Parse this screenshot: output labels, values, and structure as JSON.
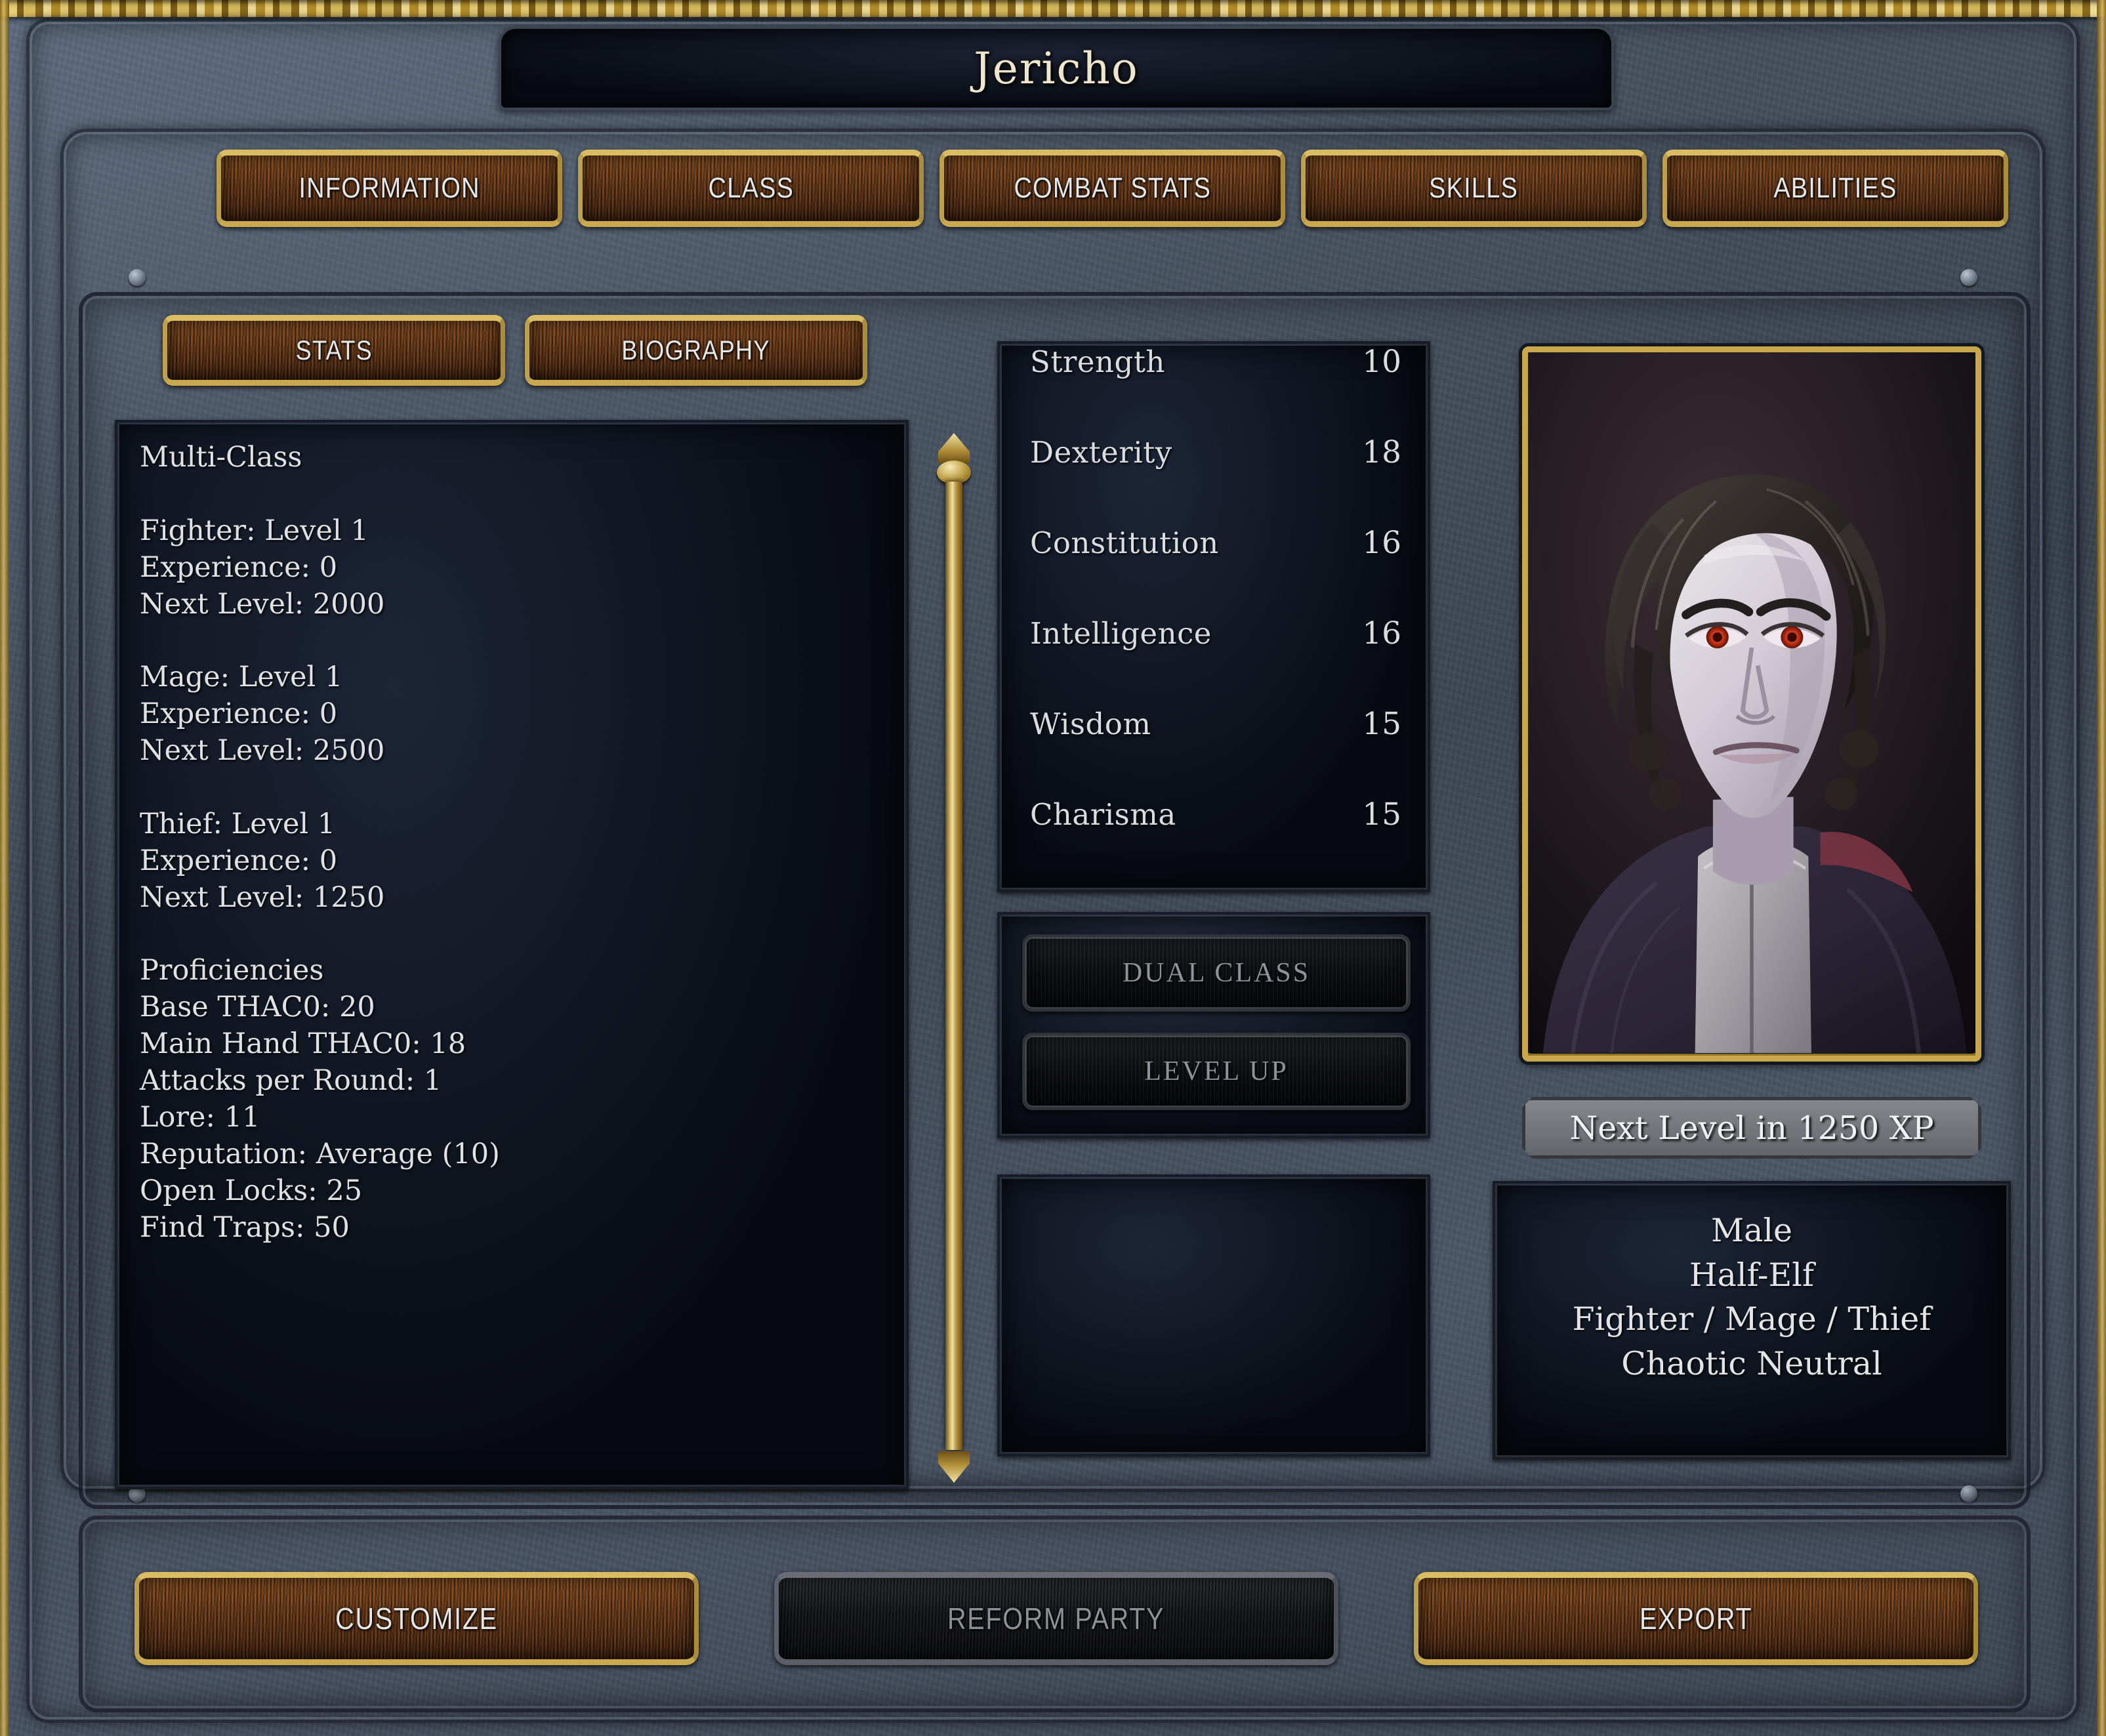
{
  "window": {
    "character_name": "Jericho"
  },
  "main_tabs": [
    {
      "label": "INFORMATION",
      "state": "active"
    },
    {
      "label": "CLASS",
      "state": "normal"
    },
    {
      "label": "COMBAT STATS",
      "state": "normal"
    },
    {
      "label": "SKILLS",
      "state": "normal"
    },
    {
      "label": "ABILITIES",
      "state": "normal"
    }
  ],
  "sub_tabs": [
    {
      "label": "STATS",
      "state": "active"
    },
    {
      "label": "BIOGRAPHY",
      "state": "normal"
    }
  ],
  "stats_text": "Multi-Class\n\nFighter: Level 1\nExperience: 0\nNext Level: 2000\n\nMage: Level 1\nExperience: 0\nNext Level: 2500\n\nThief: Level 1\nExperience: 0\nNext Level: 1250\n\nProficiencies\nBase THAC0: 20\nMain Hand THAC0: 18\nAttacks per Round: 1\nLore: 11\nReputation: Average (10)\nOpen Locks: 25\nFind Traps: 50",
  "class_summary": {
    "type": "Multi-Class",
    "classes": [
      {
        "name": "Fighter",
        "level": 1,
        "experience": 0,
        "next_level": 2000
      },
      {
        "name": "Mage",
        "level": 1,
        "experience": 0,
        "next_level": 2500
      },
      {
        "name": "Thief",
        "level": 1,
        "experience": 0,
        "next_level": 1250
      }
    ],
    "proficiencies": {
      "heading": "Proficiencies",
      "base_thac0": 20,
      "main_hand_thac0": 18,
      "attacks_per_round": 1,
      "lore": 11,
      "reputation": "Average (10)",
      "open_locks": 25,
      "find_traps": 50
    }
  },
  "abilities": [
    {
      "name": "Strength",
      "value": "10"
    },
    {
      "name": "Dexterity",
      "value": "18"
    },
    {
      "name": "Constitution",
      "value": "16"
    },
    {
      "name": "Intelligence",
      "value": "16"
    },
    {
      "name": "Wisdom",
      "value": "15"
    },
    {
      "name": "Charisma",
      "value": "15"
    }
  ],
  "actions": [
    {
      "label": "DUAL CLASS",
      "state": "disabled"
    },
    {
      "label": "LEVEL UP",
      "state": "disabled"
    }
  ],
  "xp_badge": {
    "label": "Next Level in 1250 XP"
  },
  "character_info": {
    "gender": "Male",
    "race": "Half-Elf",
    "classes": "Fighter / Mage / Thief",
    "alignment": "Chaotic Neutral"
  },
  "bottom_buttons": [
    {
      "label": "CUSTOMIZE",
      "state": "normal"
    },
    {
      "label": "REFORM PARTY",
      "state": "disabled"
    },
    {
      "label": "EXPORT",
      "state": "normal"
    }
  ],
  "colors": {
    "gold": "#c9a84c",
    "leather_brown": "#703b14",
    "text_cream": "#efe5cb",
    "text_light": "#dfe1e4",
    "disabled_text": "#8f9299",
    "panel_dark": "#0a0e16",
    "stone_blue": "#47525f"
  }
}
